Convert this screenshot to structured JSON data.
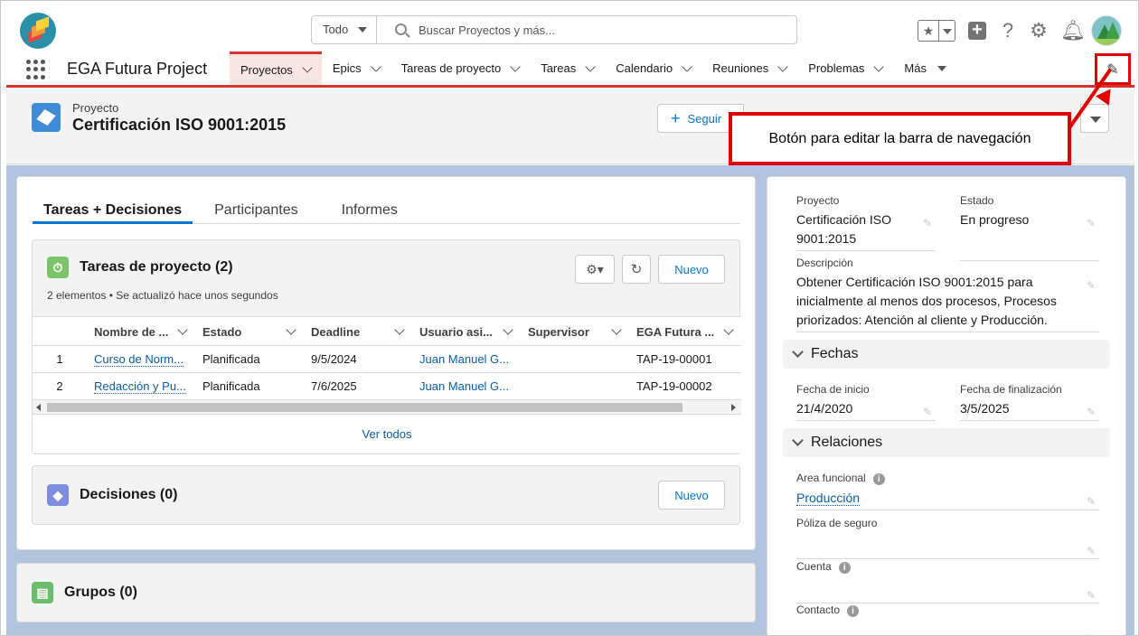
{
  "header": {
    "search_scope": "Todo",
    "search_placeholder": "Buscar Proyectos y más..."
  },
  "nav": {
    "app_name": "EGA Futura Project",
    "tabs": [
      "Proyectos",
      "Epics",
      "Tareas de proyecto",
      "Tareas",
      "Calendario",
      "Reuniones",
      "Problemas",
      "Más"
    ]
  },
  "record": {
    "object_type": "Proyecto",
    "title": "Certificación ISO 9001:2015",
    "follow_label": "Seguir"
  },
  "callout": {
    "text": "Botón para editar la barra de navegación"
  },
  "main_tabs": [
    "Tareas + Decisiones",
    "Participantes",
    "Informes"
  ],
  "tasks": {
    "title": "Tareas de proyecto (2)",
    "subtitle": "2 elementos • Se actualizó hace unos segundos",
    "new_label": "Nuevo",
    "columns": [
      "Nombre de ...",
      "Estado",
      "Deadline",
      "Usuario asi...",
      "Supervisor",
      "EGA Futura ..."
    ],
    "rows": [
      {
        "num": "1",
        "name": "Curso de Norm...",
        "status": "Planificada",
        "deadline": "9/5/2024",
        "user": "Juan Manuel G...",
        "supervisor": "",
        "code": "TAP-19-00001"
      },
      {
        "num": "2",
        "name": "Redacción y Pu...",
        "status": "Planificada",
        "deadline": "7/6/2025",
        "user": "Juan Manuel G...",
        "supervisor": "",
        "code": "TAP-19-00002"
      }
    ],
    "view_all": "Ver todos"
  },
  "decisions": {
    "title": "Decisiones (0)",
    "new_label": "Nuevo"
  },
  "groups": {
    "title": "Grupos (0)"
  },
  "details": {
    "proyecto_label": "Proyecto",
    "proyecto_value": "Certificación ISO 9001:2015",
    "estado_label": "Estado",
    "estado_value": "En progreso",
    "descripcion_label": "Descripción",
    "descripcion_value": "Obtener Certificación ISO 9001:2015 para inicialmente al menos dos procesos, Procesos priorizados: Atención al cliente y Producción.",
    "fechas_section": "Fechas",
    "fecha_inicio_label": "Fecha de inicio",
    "fecha_inicio_value": "21/4/2020",
    "fecha_fin_label": "Fecha de finalización",
    "fecha_fin_value": "3/5/2025",
    "relaciones_section": "Relaciones",
    "area_label": "Area funcional",
    "area_value": "Producción",
    "poliza_label": "Póliza de seguro",
    "cuenta_label": "Cuenta",
    "contacto_label": "Contacto"
  }
}
